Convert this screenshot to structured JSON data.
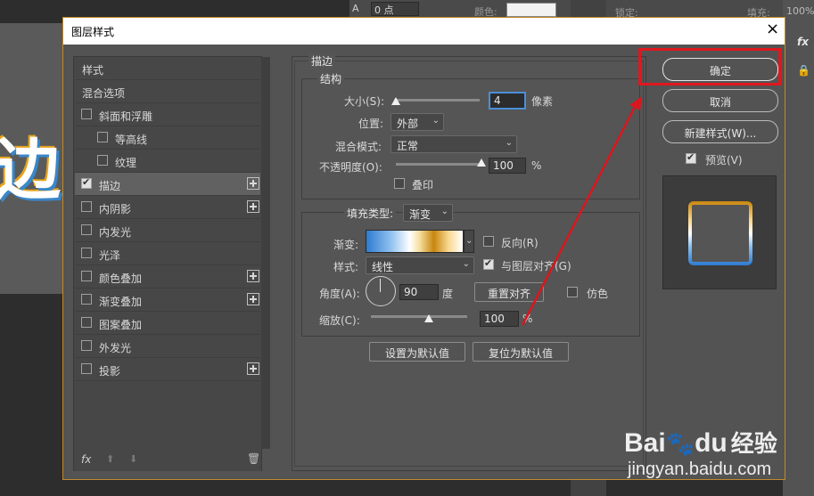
{
  "background": {
    "text_size_value": "0 点",
    "color_label": "颜色:",
    "lock_label": "锁定:",
    "fill_label": "填充:",
    "fill_value": "100%",
    "fx_label": "fx",
    "canvas_char": "边"
  },
  "dialog": {
    "title": "图层样式",
    "close": "×"
  },
  "styles_list": [
    {
      "label": "样式",
      "checkbox": false,
      "checked": false,
      "plus": false,
      "indent": 0
    },
    {
      "label": "混合选项",
      "checkbox": false,
      "checked": false,
      "plus": false,
      "indent": 0
    },
    {
      "label": "斜面和浮雕",
      "checkbox": true,
      "checked": false,
      "plus": false,
      "indent": 0
    },
    {
      "label": "等高线",
      "checkbox": true,
      "checked": false,
      "plus": false,
      "indent": 1
    },
    {
      "label": "纹理",
      "checkbox": true,
      "checked": false,
      "plus": false,
      "indent": 1
    },
    {
      "label": "描边",
      "checkbox": true,
      "checked": true,
      "plus": true,
      "indent": 0,
      "selected": true
    },
    {
      "label": "内阴影",
      "checkbox": true,
      "checked": false,
      "plus": true,
      "indent": 0
    },
    {
      "label": "内发光",
      "checkbox": true,
      "checked": false,
      "plus": false,
      "indent": 0
    },
    {
      "label": "光泽",
      "checkbox": true,
      "checked": false,
      "plus": false,
      "indent": 0
    },
    {
      "label": "颜色叠加",
      "checkbox": true,
      "checked": false,
      "plus": true,
      "indent": 0
    },
    {
      "label": "渐变叠加",
      "checkbox": true,
      "checked": false,
      "plus": true,
      "indent": 0
    },
    {
      "label": "图案叠加",
      "checkbox": true,
      "checked": false,
      "plus": false,
      "indent": 0
    },
    {
      "label": "外发光",
      "checkbox": true,
      "checked": false,
      "plus": false,
      "indent": 0
    },
    {
      "label": "投影",
      "checkbox": true,
      "checked": false,
      "plus": true,
      "indent": 0
    }
  ],
  "list_footer": {
    "fx": "fx",
    "up": "⬆",
    "down": "⬇",
    "trash": "🗑"
  },
  "stroke": {
    "section_title": "描边",
    "structure_title": "结构",
    "size_label": "大小(S):",
    "size_value": "4",
    "size_unit": "像素",
    "size_slider": 0.02,
    "position_label": "位置:",
    "position_value": "外部",
    "blend_label": "混合模式:",
    "blend_value": "正常",
    "opacity_label": "不透明度(O):",
    "opacity_value": "100",
    "opacity_unit": "%",
    "opacity_slider": 1.0,
    "overprint_label": "叠印",
    "fill_type_label": "填充类型:",
    "fill_type_value": "渐变",
    "gradient_label": "渐变:",
    "reverse_label": "反向(R)",
    "style_label": "样式:",
    "style_value": "线性",
    "align_label": "与图层对齐(G)",
    "angle_label": "角度(A):",
    "angle_value": "90",
    "angle_unit": "度",
    "reset_align_label": "重置对齐",
    "dither_label": "仿色",
    "scale_label": "缩放(C):",
    "scale_value": "100",
    "scale_unit": "%",
    "scale_slider": 0.6,
    "set_default_label": "设置为默认值",
    "reset_default_label": "复位为默认值"
  },
  "right": {
    "ok_label": "确定",
    "cancel_label": "取消",
    "new_style_label": "新建样式(W)...",
    "preview_label": "预览(V)"
  },
  "watermark": {
    "brand": "Bai",
    "brand2": "du",
    "product": "经验",
    "url": "jingyan.baidu.com"
  },
  "colors": {
    "highlight": "#e0171e",
    "arrow": "#d9171e",
    "dialog_border": "#c08a2b"
  }
}
